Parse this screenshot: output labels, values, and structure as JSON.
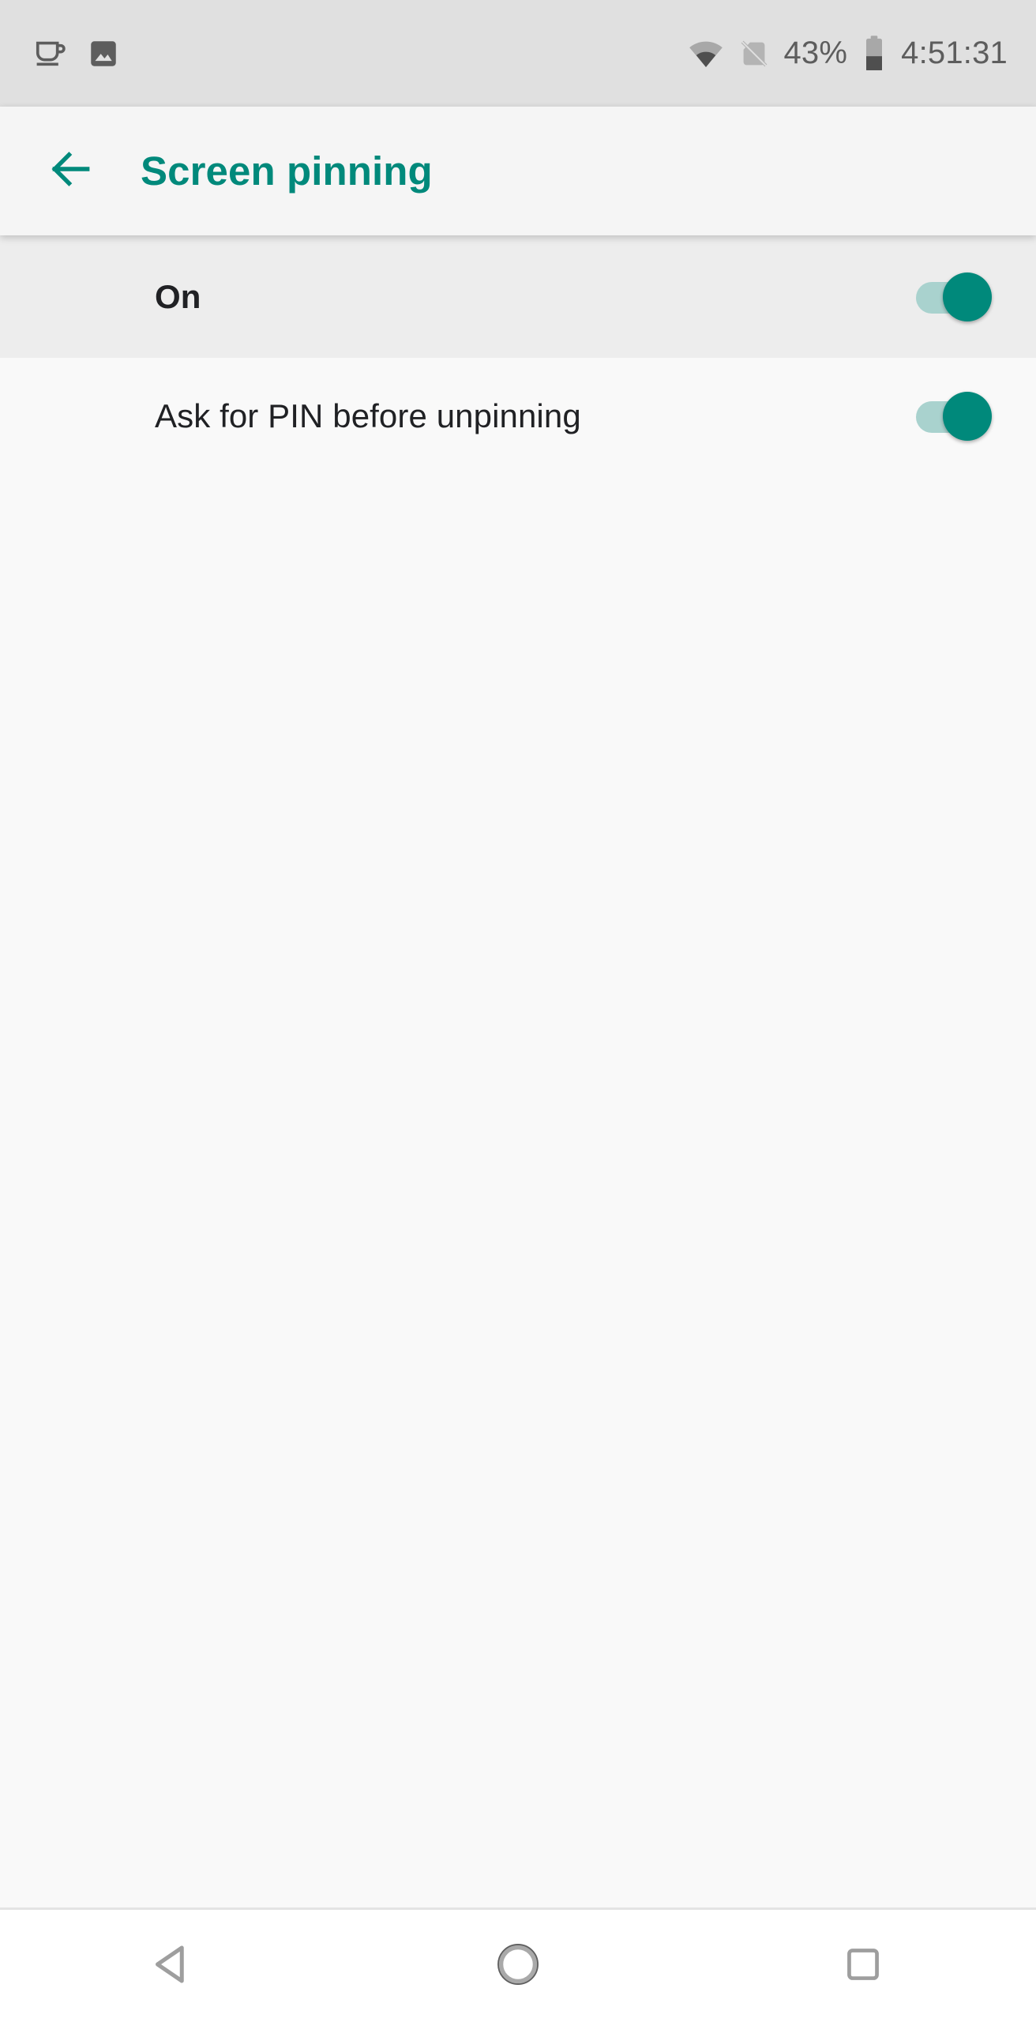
{
  "status_bar": {
    "notification_icons": [
      "coffee-cup-icon",
      "photo-image-icon"
    ],
    "wifi_icon": "wifi-icon",
    "sim_icon": "no-sim-card-icon",
    "battery_percent": "43%",
    "battery_level": 43,
    "battery_icon": "battery-icon",
    "time": "4:51:31",
    "background": "#e0e0e0",
    "foreground": "#5d5d5d"
  },
  "app_bar": {
    "back_icon": "arrow-left-icon",
    "title": "Screen pinning",
    "accent_color": "#00897b",
    "background": "#f5f5f5"
  },
  "settings": {
    "rows": [
      {
        "title": "On",
        "switch_state": "on",
        "emphasis": "master",
        "background": "#ededed"
      },
      {
        "title": "Ask for PIN before unpinning",
        "switch_state": "on",
        "emphasis": "normal",
        "background": "#f9f9f9"
      }
    ],
    "switch_track_color": "#a9d2ce",
    "switch_thumb_color": "#00897b"
  },
  "nav_bar": {
    "buttons": [
      {
        "name": "back",
        "icon": "triangle-back-icon"
      },
      {
        "name": "home",
        "icon": "circle-home-icon"
      },
      {
        "name": "recents",
        "icon": "square-recents-icon"
      }
    ],
    "icon_color": "#9e9e9e",
    "background": "#ffffff"
  }
}
